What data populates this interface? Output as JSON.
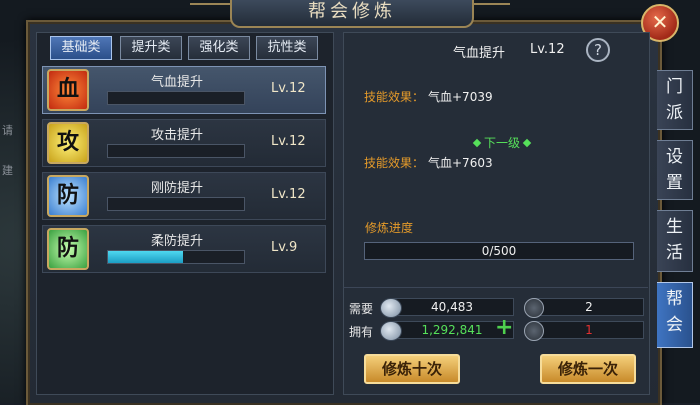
{
  "window": {
    "title": "帮会修炼",
    "close": "✕"
  },
  "background": {
    "partial_text_1": "请",
    "partial_text_2": "建"
  },
  "category_tabs": [
    {
      "label": "基础类"
    },
    {
      "label": "提升类"
    },
    {
      "label": "强化类"
    },
    {
      "label": "抗性类"
    }
  ],
  "skills": [
    {
      "name": "气血提升",
      "level": "Lv.12",
      "icon_char": "血",
      "progress": 0
    },
    {
      "name": "攻击提升",
      "level": "Lv.12",
      "icon_char": "攻",
      "progress": 0
    },
    {
      "name": "刚防提升",
      "level": "Lv.12",
      "icon_char": "防",
      "progress": 0
    },
    {
      "name": "柔防提升",
      "level": "Lv.9",
      "icon_char": "防",
      "progress": 0.55
    }
  ],
  "detail": {
    "title": "气血提升",
    "level": "Lv.12",
    "help": "?",
    "effect_label": "技能效果：",
    "effect_current": "气血+7039",
    "next_level_label": "下一级",
    "effect_next": "气血+7603",
    "progress_label": "修炼进度",
    "progress_text": "0/500"
  },
  "resources": {
    "need_label": "需要",
    "have_label": "拥有",
    "need_silver": "40,483",
    "need_item": "2",
    "have_silver": "1,292,841",
    "have_item": "1",
    "plus": "+"
  },
  "buttons": {
    "train_ten": "修炼十次",
    "train_once": "修炼一次"
  },
  "side_tabs": [
    {
      "label": "门派",
      "chars": [
        "门",
        "派"
      ]
    },
    {
      "label": "设置",
      "chars": [
        "设",
        "置"
      ]
    },
    {
      "label": "生活",
      "chars": [
        "生",
        "活"
      ]
    },
    {
      "label": "帮会",
      "chars": [
        "帮",
        "会"
      ]
    }
  ],
  "colors": {
    "effect_label": "#e49a2a",
    "next_level": "#56e05a",
    "have_silver": "#56e05a",
    "have_item_insufficient": "#e03030",
    "active_tab": "#3f74c2"
  }
}
